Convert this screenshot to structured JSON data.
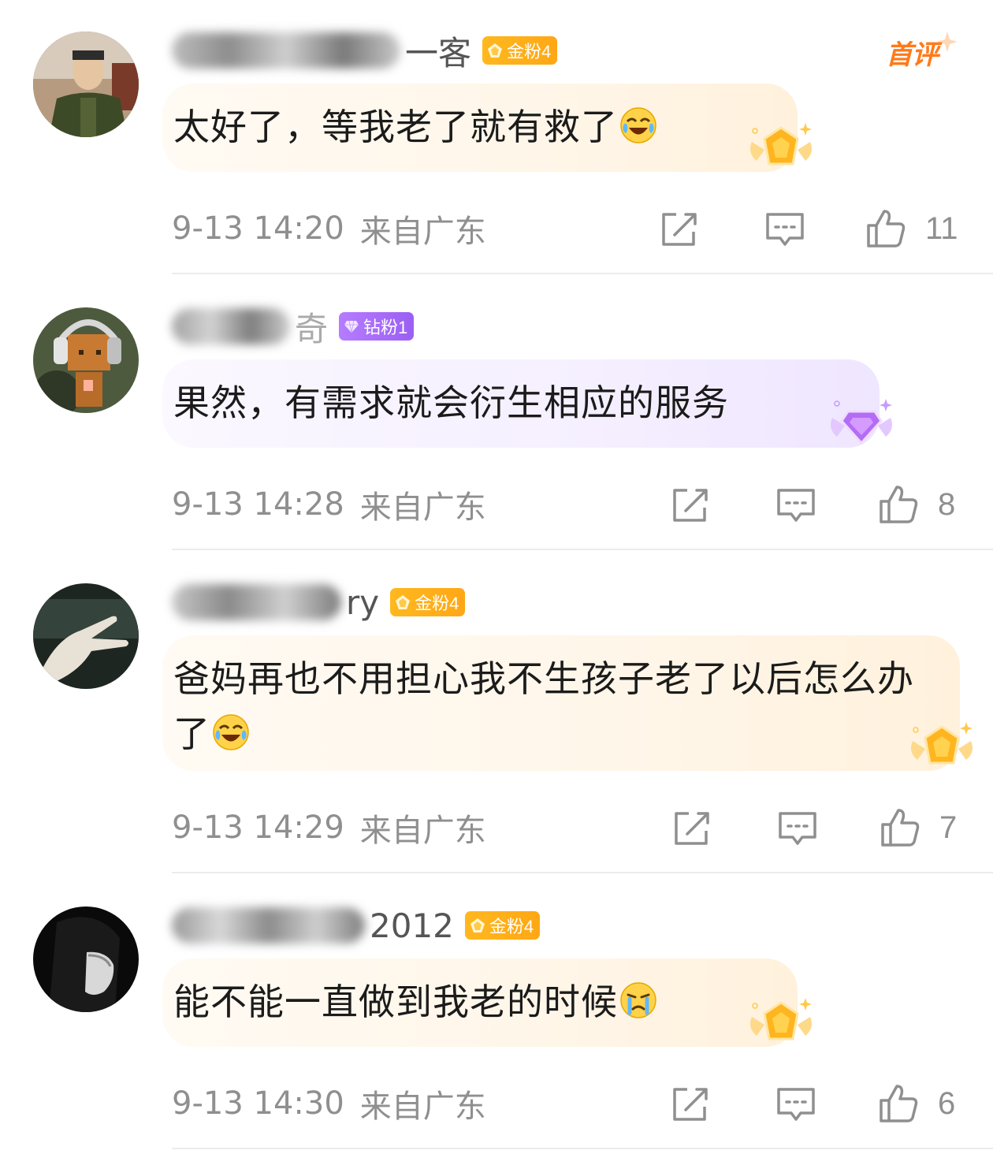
{
  "first_tag": "首评",
  "comments": [
    {
      "name_suffix": "一客",
      "badge": "金粉4",
      "text": "太好了，等我老了就有救了",
      "time": "9-13 14:20",
      "location": "来自广东",
      "likes": "11"
    },
    {
      "name_suffix": "奇",
      "badge": "钻粉1",
      "text": "果然，有需求就会衍生相应的服务",
      "time": "9-13 14:28",
      "location": "来自广东",
      "likes": "8"
    },
    {
      "name_suffix": "ry",
      "badge": "金粉4",
      "text": "爸妈再也不用担心我不生孩子老了以后怎么办了",
      "time": "9-13 14:29",
      "location": "来自广东",
      "likes": "7"
    },
    {
      "name_suffix": "2012",
      "badge": "金粉4",
      "text": "能不能一直做到我老的时候",
      "time": "9-13 14:30",
      "location": "来自广东",
      "likes": "6"
    }
  ],
  "colors": {
    "gold_badge": "#ffb01a",
    "diamond_badge": "#a56cf7",
    "first_tag": "#ff7a1a",
    "meta_text": "#8f8f8f"
  },
  "icons": {
    "share": "share-square-icon",
    "comment": "comment-bubble-icon",
    "like": "thumbs-up-icon"
  }
}
